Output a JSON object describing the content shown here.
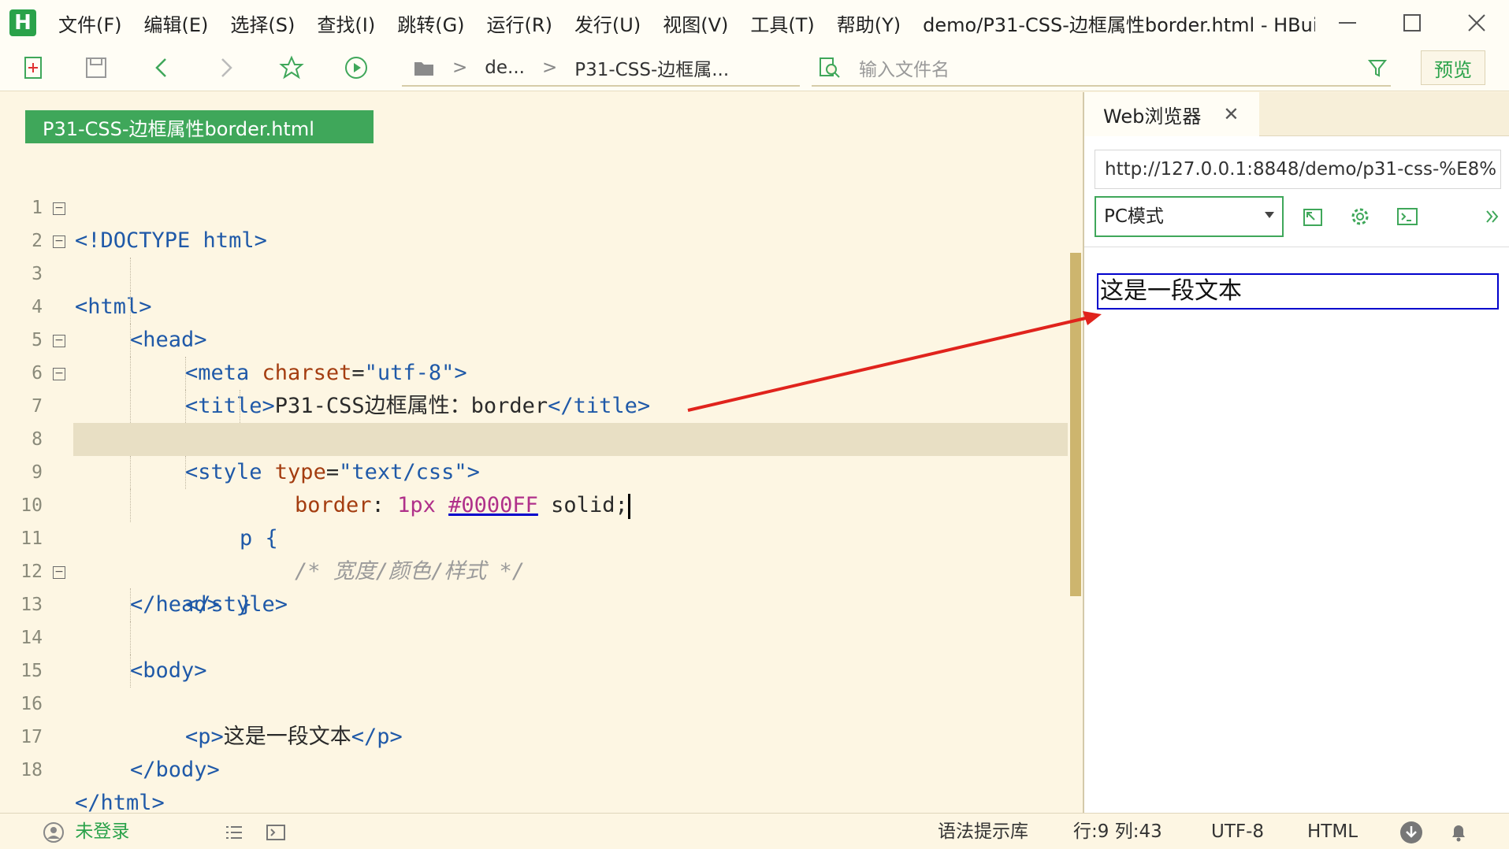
{
  "app": {
    "logo_letter": "H",
    "window_title": "demo/P31-CSS-边框属性border.html - HBui...",
    "menu": [
      "文件(F)",
      "编辑(E)",
      "选择(S)",
      "查找(I)",
      "跳转(G)",
      "运行(R)",
      "发行(U)",
      "视图(V)",
      "工具(T)",
      "帮助(Y)"
    ]
  },
  "toolbar": {
    "breadcrumb": [
      "de...",
      "P31-CSS-边框属..."
    ],
    "search_placeholder": "输入文件名",
    "preview_label": "预览"
  },
  "editor": {
    "tab_label": "P31-CSS-边框属性border.html",
    "line_numbers": [
      "1",
      "2",
      "3",
      "4",
      "5",
      "6",
      "7",
      "8",
      "9",
      "10",
      "11",
      "12",
      "13",
      "14",
      "15",
      "16",
      "17",
      "18"
    ],
    "code": {
      "l1": "<!DOCTYPE html>",
      "l2": "<html>",
      "l3": "<head>",
      "l4_tag": "<meta ",
      "l4_attr": "charset",
      "l4_eq": "=",
      "l4_val": "\"utf-8\"",
      "l4_close": ">",
      "l5_open": "<title>",
      "l5_text": "P31-CSS边框属性：border",
      "l5_close": "</title>",
      "l6_tag": "<style ",
      "l6_attr": "type",
      "l6_eq": "=",
      "l6_val": "\"text/css\"",
      "l6_close": ">",
      "l7": "p {",
      "l8": "/* 宽度/颜色/样式 */",
      "l9_prop": "border",
      "l9_colon": ": ",
      "l9_num": "1px",
      "l9_hex": "#0000FF",
      "l9_style": "solid;",
      "l10": "}",
      "l11": "</style>",
      "l12": "</head>",
      "l13": "<body>",
      "l15_open": "<p>",
      "l15_text": "这是一段文本",
      "l15_close": "</p>",
      "l17": "</body>",
      "l18": "</html>"
    }
  },
  "browser": {
    "tab_label": "Web浏览器",
    "url": "http://127.0.0.1:8848/demo/p31-css-%E8%",
    "mode": "PC模式",
    "rendered_text": "这是一段文本"
  },
  "statusbar": {
    "login": "未登录",
    "syntax_lib": "语法提示库",
    "position": "行:9  列:43",
    "encoding": "UTF-8",
    "language": "HTML"
  },
  "colors": {
    "accent": "#3fa75a",
    "border_sample": "#0000FF",
    "annotation": "#e0231c"
  }
}
